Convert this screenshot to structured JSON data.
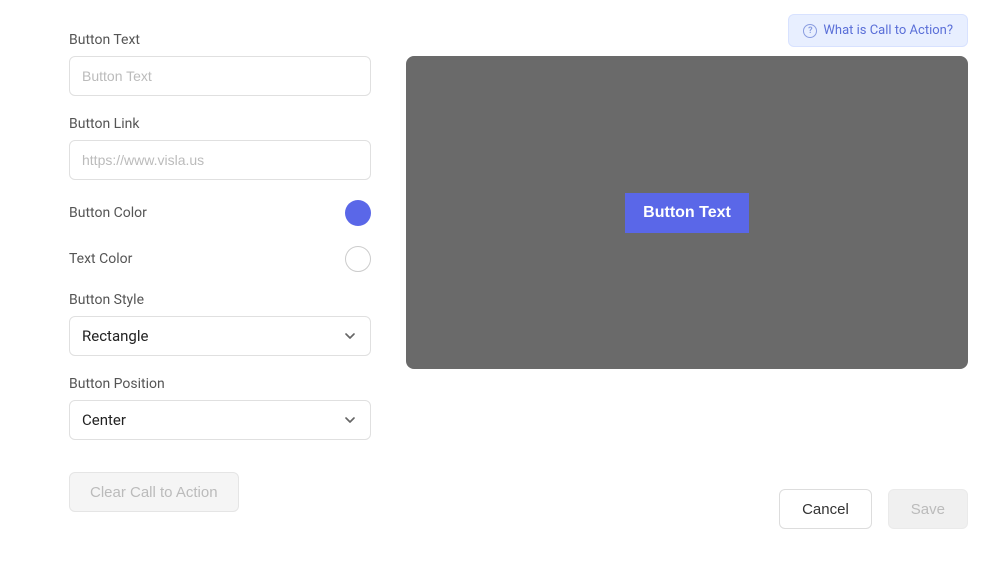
{
  "help": {
    "label": "What is Call to Action?"
  },
  "form": {
    "button_text": {
      "label": "Button Text",
      "placeholder": "Button Text",
      "value": ""
    },
    "button_link": {
      "label": "Button Link",
      "placeholder": "https://www.visla.us",
      "value": ""
    },
    "button_color": {
      "label": "Button Color",
      "value": "#5a67e8"
    },
    "text_color": {
      "label": "Text Color",
      "value": "#ffffff"
    },
    "button_style": {
      "label": "Button Style",
      "selected": "Rectangle"
    },
    "button_position": {
      "label": "Button Position",
      "selected": "Center"
    }
  },
  "actions": {
    "clear": "Clear Call to Action",
    "cancel": "Cancel",
    "save": "Save"
  },
  "preview": {
    "button_text": "Button Text"
  }
}
